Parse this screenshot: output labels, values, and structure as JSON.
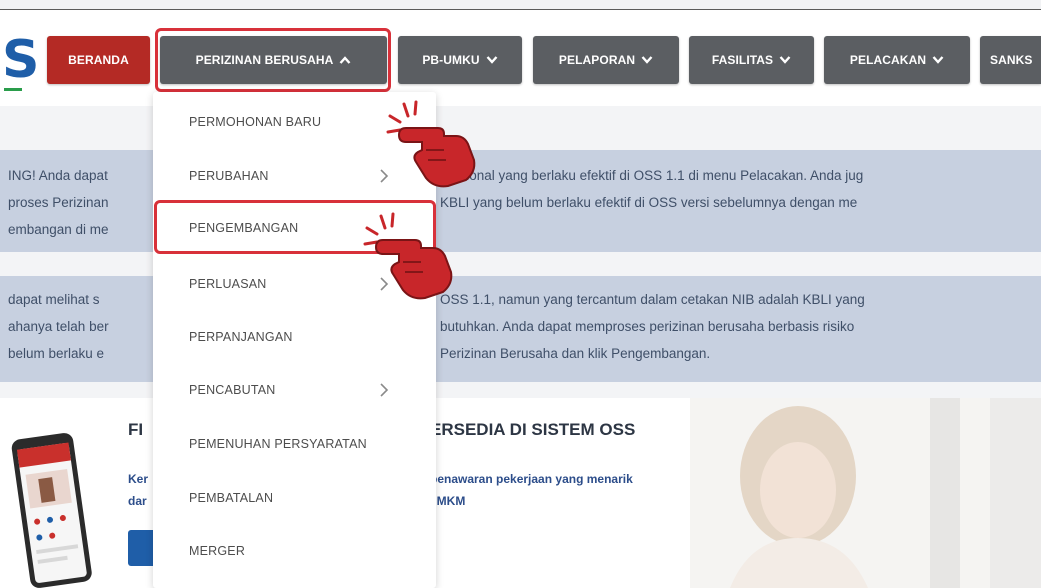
{
  "logo": {
    "fragment": "S"
  },
  "nav": {
    "items": [
      {
        "label": "BERANDA",
        "has_chevron": false
      },
      {
        "label": "PERIZINAN BERUSAHA",
        "chevron": "up",
        "active": true
      },
      {
        "label": "PB-UMKU",
        "chevron": "down"
      },
      {
        "label": "PELAPORAN",
        "chevron": "down"
      },
      {
        "label": "FASILITAS",
        "chevron": "down"
      },
      {
        "label": "PELACAKAN",
        "chevron": "down"
      },
      {
        "label": "SANKS",
        "chevron": null
      }
    ]
  },
  "dropdown": {
    "items": [
      {
        "label": "PERMOHONAN BARU",
        "submenu": false
      },
      {
        "label": "PERUBAHAN",
        "submenu": true
      },
      {
        "label": "PENGEMBANGAN",
        "submenu": false,
        "highlighted": true
      },
      {
        "label": "PERLUASAN",
        "submenu": true
      },
      {
        "label": "PERPANJANGAN",
        "submenu": false
      },
      {
        "label": "PENCABUTAN",
        "submenu": true
      },
      {
        "label": "PEMENUHAN PERSYARATAN",
        "submenu": false
      },
      {
        "label": "PEMBATALAN",
        "submenu": false
      },
      {
        "label": "MERGER",
        "submenu": false
      }
    ]
  },
  "alerts": [
    {
      "lines": [
        {
          "left": "ING! Anda dapat",
          "right": "erasional yang berlaku efektif di OSS 1.1 di menu Pelacakan. Anda jug"
        },
        {
          "left": "proses Perizinan",
          "right": "KBLI yang belum berlaku efektif di OSS versi sebelumnya dengan me"
        },
        {
          "left": "embangan di me",
          "right": ""
        }
      ]
    },
    {
      "lines": [
        {
          "left": "dapat melihat s",
          "right": "OSS 1.1, namun yang tercantum dalam cetakan NIB adalah KBLI yang"
        },
        {
          "left": "ahanya telah ber",
          "right": "butuhkan. Anda dapat memproses perizinan berusaha berbasis risiko"
        },
        {
          "left": "belum berlaku e",
          "right": "Perizinan Berusaha dan klik Pengembangan."
        }
      ]
    }
  ],
  "promo": {
    "title_left": "FI",
    "title_right": "ERSEDIA DI SISTEM OSS",
    "text_left_1": "Ker",
    "text_left_2": "dar",
    "text_right_1": "penawaran pekerjaan yang menarik",
    "text_right_2": "JMKM"
  },
  "icons": {
    "chevron_up": "chevron-up-icon",
    "chevron_down": "chevron-down-icon",
    "chevron_right": "chevron-right-icon",
    "hand": "pointing-hand-icon"
  },
  "colors": {
    "accent_red": "#b42a25",
    "nav_gray": "#5b5e62",
    "highlight_red": "#d8313a",
    "alert_bg": "#c7d0e0",
    "brand_blue": "#1f5ea8"
  }
}
